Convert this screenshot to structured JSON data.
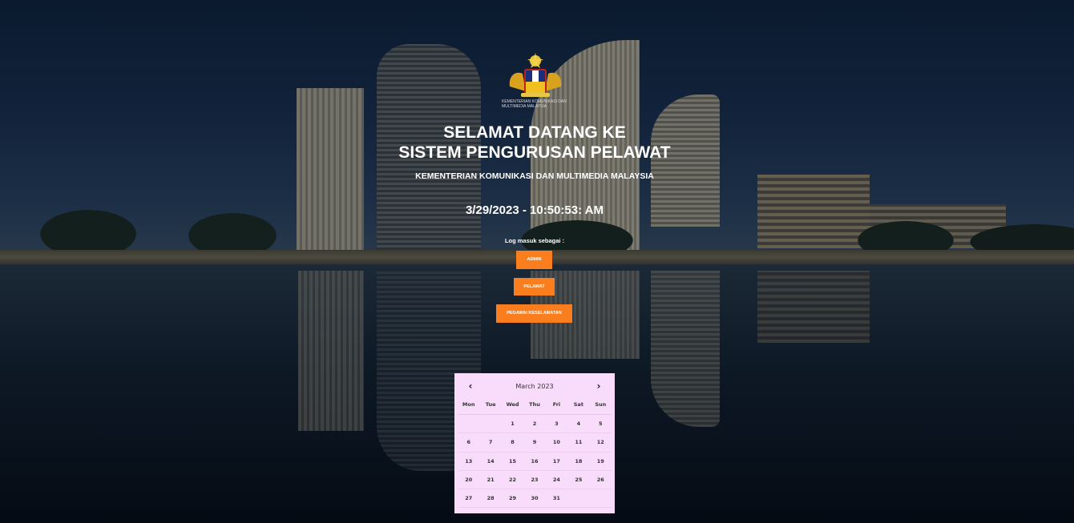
{
  "header": {
    "crest_caption": "KEMENTERIAN KOMUNIKASI DAN MULTIMEDIA MALAYSIA",
    "title_line1": "SELAMAT DATANG KE",
    "title_line2": "SISTEM PENGURUSAN PELAWAT",
    "subtitle": "KEMENTERIAN KOMUNIKASI DAN MULTIMEDIA MALAYSIA",
    "clock": "3/29/2023 - 10:50:53: AM"
  },
  "login": {
    "label": "Log masuk sebagai :",
    "buttons": {
      "admin": "ADMIN",
      "pelawat": "PELAWAT",
      "pegawai": "PEGAWAI KESELAMATAN"
    },
    "button_color": "#fa7d1e"
  },
  "calendar": {
    "month_label": "March 2023",
    "prev_icon": "‹",
    "next_icon": "›",
    "weekdays": [
      "Mon",
      "Tue",
      "Wed",
      "Thu",
      "Fri",
      "Sat",
      "Sun"
    ],
    "days": [
      "",
      "",
      "1",
      "2",
      "3",
      "4",
      "5",
      "6",
      "7",
      "8",
      "9",
      "10",
      "11",
      "12",
      "13",
      "14",
      "15",
      "16",
      "17",
      "18",
      "19",
      "20",
      "21",
      "22",
      "23",
      "24",
      "25",
      "26",
      "27",
      "28",
      "29",
      "30",
      "31",
      "",
      ""
    ],
    "background": "#f9dcfb"
  }
}
